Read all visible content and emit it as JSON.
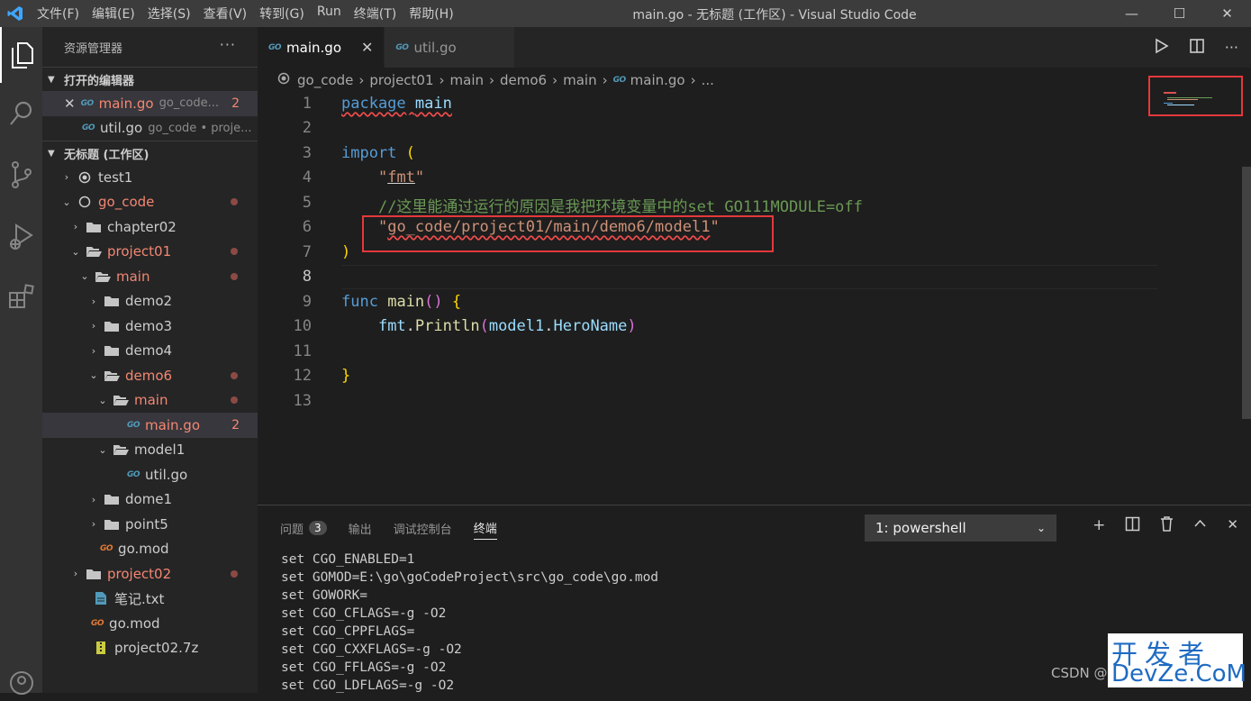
{
  "titlebar": {
    "menu": [
      "文件(F)",
      "编辑(E)",
      "选择(S)",
      "查看(V)",
      "转到(G)",
      "Run",
      "终端(T)",
      "帮助(H)"
    ],
    "window_title": "main.go - 无标题 (工作区) - Visual Studio Code",
    "minimize": "—",
    "maximize": "☐",
    "close": "✕"
  },
  "sidebar": {
    "title": "资源管理器",
    "more": "···",
    "open_editors_header": "打开的编辑器",
    "open_editors": [
      {
        "name": "main.go",
        "desc": "go_code...",
        "count": "2",
        "close": "✕"
      },
      {
        "name": "util.go",
        "desc": "go_code • proje..."
      }
    ],
    "workspace_header": "无标题 (工作区)",
    "tree": {
      "test1": "test1",
      "go_code": "go_code",
      "chapter02": "chapter02",
      "project01": "project01",
      "main": "main",
      "demo2": "demo2",
      "demo3": "demo3",
      "demo4": "demo4",
      "demo6": "demo6",
      "demo6_main": "main",
      "main_go": "main.go",
      "main_go_count": "2",
      "model1": "model1",
      "util_go": "util.go",
      "dome1": "dome1",
      "point5": "point5",
      "gomod1": "go.mod",
      "project02": "project02",
      "notes": "笔记.txt",
      "gomod2": "go.mod",
      "archive": "project02.7z"
    }
  },
  "tabs": [
    {
      "label": "main.go",
      "close": "✕"
    },
    {
      "label": "util.go"
    }
  ],
  "breadcrumb": [
    "go_code",
    "project01",
    "main",
    "demo6",
    "main",
    "main.go",
    "..."
  ],
  "editor": {
    "line_numbers": [
      "1",
      "2",
      "3",
      "4",
      "5",
      "6",
      "7",
      "8",
      "9",
      "10",
      "11",
      "12",
      "13"
    ],
    "l1_kw": "package",
    "l1_id": "main",
    "l3_kw": "import",
    "l3_p": "(",
    "l4_q1": "\"",
    "l4_s": "fmt",
    "l4_q2": "\"",
    "l5": "//这里能通过运行的原因是我把环境变量中的set GO111MODULE=off",
    "l6_q1": "\"",
    "l6_s": "go_code/project01/main/demo6/model1",
    "l6_q2": "\"",
    "l7": ")",
    "l9_kw": "func",
    "l9_fn": "main",
    "l9_p": "()",
    "l9_b": "{",
    "l10_a": "fmt",
    "l10_b": ".",
    "l10_c": "Println",
    "l10_d": "(",
    "l10_e": "model1",
    "l10_f": ".",
    "l10_g": "HeroName",
    "l10_h": ")",
    "l12": "}"
  },
  "panel": {
    "tabs": [
      "问题",
      "输出",
      "调试控制台",
      "终端"
    ],
    "problems_count": "3",
    "terminal_select": "1: powershell",
    "terminal_lines": [
      "set CGO_ENABLED=1",
      "set GOMOD=E:\\go\\goCodeProject\\src\\go_code\\go.mod",
      "set GOWORK=",
      "set CGO_CFLAGS=-g -O2",
      "set CGO_CPPFLAGS=",
      "set CGO_CXXFLAGS=-g -O2",
      "set CGO_FFLAGS=-g -O2",
      "set CGO_LDFLAGS=-g -O2"
    ]
  },
  "watermark": {
    "csdn": "CSDN @",
    "line1": "开发者",
    "line2": "DevZe.CoM"
  },
  "colors": {
    "accent": "#007acc",
    "error": "#f48771",
    "highlight_box": "#e5383b"
  }
}
